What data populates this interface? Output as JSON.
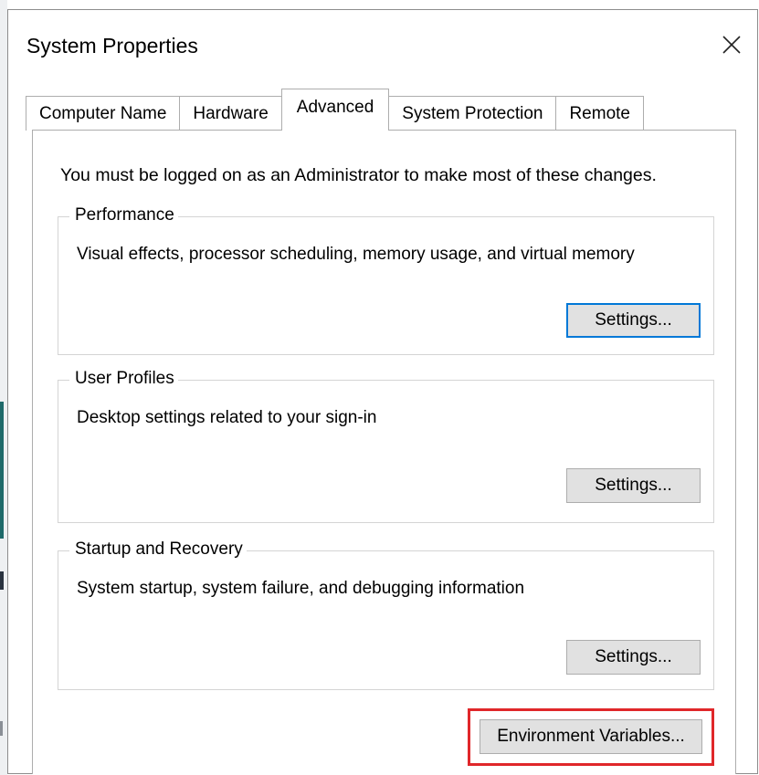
{
  "window": {
    "title": "System Properties",
    "close_icon": "close-icon"
  },
  "tabs": [
    {
      "label": "Computer Name",
      "active": false
    },
    {
      "label": "Hardware",
      "active": false
    },
    {
      "label": "Advanced",
      "active": true
    },
    {
      "label": "System Protection",
      "active": false
    },
    {
      "label": "Remote",
      "active": false
    }
  ],
  "advanced": {
    "notice": "You must be logged on as an Administrator to make most of these changes.",
    "performance": {
      "title": "Performance",
      "description": "Visual effects, processor scheduling, memory usage, and virtual memory",
      "button_label": "Settings..."
    },
    "user_profiles": {
      "title": "User Profiles",
      "description": "Desktop settings related to your sign-in",
      "button_label": "Settings..."
    },
    "startup_recovery": {
      "title": "Startup and Recovery",
      "description": "System startup, system failure, and debugging information",
      "button_label": "Settings..."
    },
    "env_button_label": "Environment Variables..."
  },
  "colors": {
    "focus_border": "#0078d7",
    "highlight": "#e0272a",
    "button_face": "#e1e1e1"
  }
}
